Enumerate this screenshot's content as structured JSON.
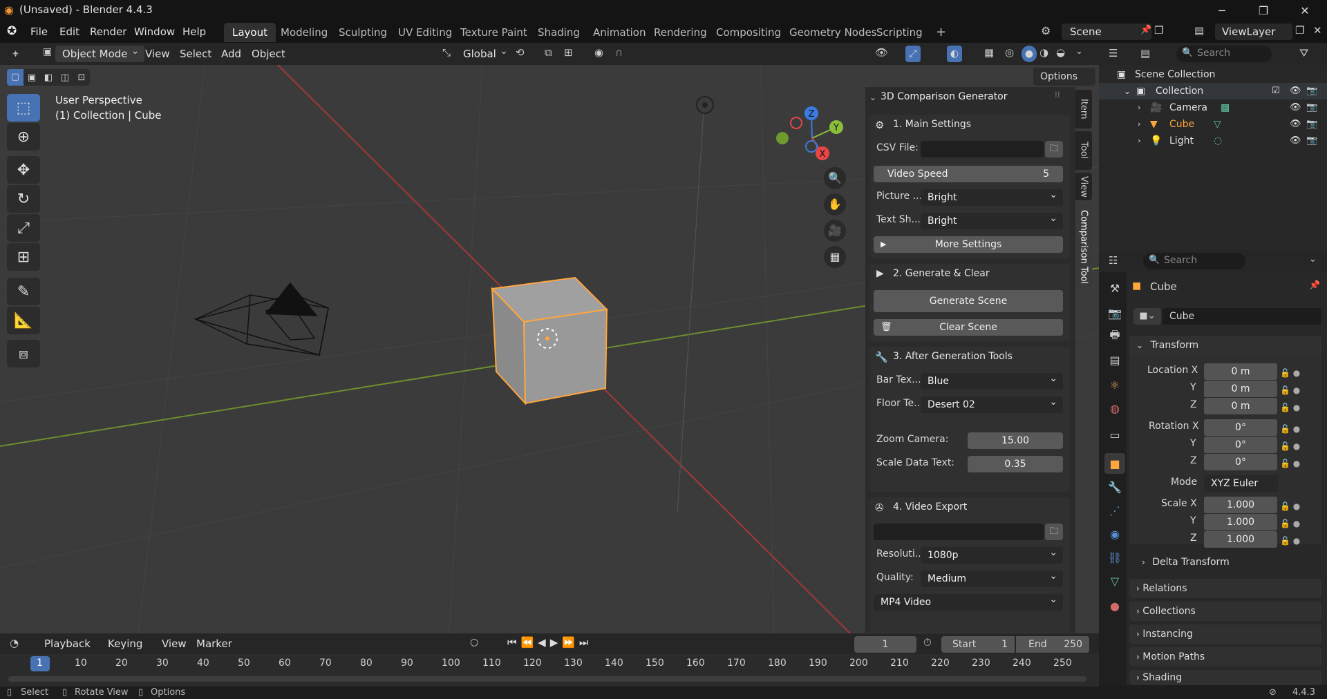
{
  "window": {
    "title": "(Unsaved) - Blender 4.4.3",
    "minimize": "─",
    "maximize": "❐",
    "close": "✕"
  },
  "menu": {
    "items": [
      "File",
      "Edit",
      "Render",
      "Window",
      "Help"
    ]
  },
  "workspaces": [
    "Layout",
    "Modeling",
    "Sculpting",
    "UV Editing",
    "Texture Paint",
    "Shading",
    "Animation",
    "Rendering",
    "Compositing",
    "Geometry Nodes",
    "Scripting"
  ],
  "workspace_add": "+",
  "scene": {
    "name": "Scene",
    "view_layer": "ViewLayer"
  },
  "viewport": {
    "mode": "Object Mode",
    "menus": [
      "View",
      "Select",
      "Add",
      "Object"
    ],
    "orientation": "Global",
    "options": "Options",
    "info_line1": "User Perspective",
    "info_line2": "(1) Collection | Cube",
    "gizmo": {
      "x": "X",
      "y": "Y",
      "z": "Z"
    }
  },
  "npanel": {
    "title": "3D Comparison Generator",
    "tabs": [
      "Item",
      "Tool",
      "View",
      "Comparison Tool"
    ],
    "main_settings": {
      "header": "1. Main Settings",
      "csv_label": "CSV File:",
      "csv_value": "",
      "video_speed_label": "Video Speed",
      "video_speed_value": "5",
      "picture_label": "Picture ...",
      "picture_value": "Bright",
      "text_label": "Text Sh...",
      "text_value": "Bright",
      "more_settings": "More Settings"
    },
    "generate": {
      "header": "2. Generate & Clear",
      "generate_btn": "Generate Scene",
      "clear_btn": "Clear Scene"
    },
    "after_gen": {
      "header": "3. After Generation Tools",
      "bar_label": "Bar Tex...",
      "bar_value": "Blue",
      "floor_label": "Floor Te...",
      "floor_value": "Desert 02",
      "zoom_label": "Zoom Camera:",
      "zoom_value": "15.00",
      "scale_label": "Scale Data Text:",
      "scale_value": "0.35"
    },
    "video_export": {
      "header": "4. Video Export",
      "path_value": "",
      "res_label": "Resoluti...",
      "res_value": "1080p",
      "quality_label": "Quality:",
      "quality_value": "Medium",
      "format_value": "MP4 Video"
    }
  },
  "outliner": {
    "search_placeholder": "Search",
    "scene_collection": "Scene Collection",
    "collection": "Collection",
    "items": [
      "Camera",
      "Cube",
      "Light"
    ]
  },
  "properties": {
    "search_placeholder": "Search",
    "object_name": "Cube",
    "data_name": "Cube",
    "transform_header": "Transform",
    "location_label": "Location X",
    "loc": [
      "0 m",
      "0 m",
      "0 m"
    ],
    "rotation_label": "Rotation X",
    "rot": [
      "0°",
      "0°",
      "0°"
    ],
    "mode_label": "Mode",
    "mode_value": "XYZ Euler",
    "scale_label": "Scale X",
    "scale": [
      "1.000",
      "1.000",
      "1.000"
    ],
    "axis_y": "Y",
    "axis_z": "Z",
    "sections": [
      "Delta Transform",
      "Relations",
      "Collections",
      "Instancing",
      "Motion Paths",
      "Shading"
    ]
  },
  "timeline": {
    "menus": [
      "Playback",
      "Keying",
      "View",
      "Marker"
    ],
    "current_frame": "1",
    "start_label": "Start",
    "start_value": "1",
    "end_label": "End",
    "end_value": "250",
    "ticks": [
      "1",
      "10",
      "20",
      "30",
      "40",
      "50",
      "60",
      "70",
      "80",
      "90",
      "100",
      "110",
      "120",
      "130",
      "140",
      "150",
      "160",
      "170",
      "180",
      "190",
      "200",
      "210",
      "220",
      "230",
      "240",
      "250"
    ]
  },
  "status": {
    "select": "Select",
    "rotate": "Rotate View",
    "options": "Options",
    "version": "4.4.3"
  },
  "colors": {
    "accent": "#4772b3",
    "selection": "#ffa63d",
    "x_axis": "#e84545",
    "y_axis": "#8bbf3a"
  }
}
